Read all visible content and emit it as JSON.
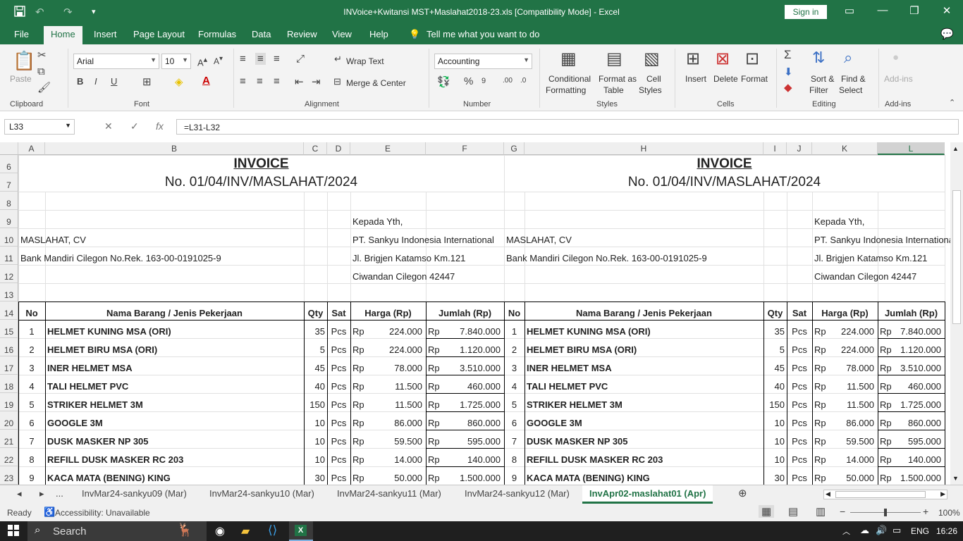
{
  "app": {
    "title": "INVoice+Kwitansi MST+Maslahat2018-23.xls  [Compatibility Mode]  -  Excel",
    "sign_in": "Sign in"
  },
  "menu_tabs": [
    "File",
    "Home",
    "Insert",
    "Page Layout",
    "Formulas",
    "Data",
    "Review",
    "View",
    "Help"
  ],
  "tell_me": "Tell me what you want to do",
  "ribbon": {
    "paste": "Paste",
    "clipboard": "Clipboard",
    "font_name": "Arial",
    "font_size": "10",
    "font_group": "Font",
    "wrap_text": "Wrap Text",
    "merge_center": "Merge & Center",
    "alignment": "Alignment",
    "number_format": "Accounting",
    "number_group": "Number",
    "conditional": "Conditional",
    "formatting": "Formatting",
    "format_as": "Format as",
    "table": "Table",
    "cell": "Cell",
    "styles_lbl": "Styles",
    "styles_group": "Styles",
    "insert": "Insert",
    "delete": "Delete",
    "format": "Format",
    "cells_group": "Cells",
    "sort": "Sort &",
    "filter": "Filter",
    "find": "Find &",
    "select": "Select",
    "editing_group": "Editing",
    "addins": "Add-ins",
    "addins_group": "Add-ins"
  },
  "formula_bar": {
    "name_box": "L33",
    "formula": "=L31-L32"
  },
  "columns": [
    "A",
    "B",
    "C",
    "D",
    "E",
    "F",
    "G",
    "H",
    "I",
    "J",
    "K",
    "L"
  ],
  "rows": [
    "6",
    "7",
    "8",
    "9",
    "10",
    "11",
    "12",
    "13",
    "14",
    "15",
    "16",
    "17",
    "18",
    "19",
    "20",
    "21",
    "22",
    "23"
  ],
  "invoice": {
    "title": "INVOICE",
    "number": "No. 01/04/INV/MASLAHAT/2024",
    "kepada": "Kepada Yth,",
    "company": "MASLAHAT, CV",
    "bank": "Bank Mandiri Cilegon No.Rek. 163-00-0191025-9",
    "client1": "PT. Sankyu Indonesia International",
    "client2": "Jl. Brigjen Katamso Km.121",
    "client3": "Ciwandan Cilegon 42447",
    "headers": [
      "No",
      "Nama Barang / Jenis Pekerjaan",
      "Qty",
      "Sat",
      "Harga (Rp)",
      "Jumlah (Rp)"
    ],
    "currency": "Rp",
    "items": [
      {
        "no": "1",
        "name": "HELMET KUNING MSA (ORI)",
        "qty": "35",
        "sat": "Pcs",
        "harga": "224.000",
        "jumlah": "7.840.000"
      },
      {
        "no": "2",
        "name": "HELMET BIRU MSA (ORI)",
        "qty": "5",
        "sat": "Pcs",
        "harga": "224.000",
        "jumlah": "1.120.000"
      },
      {
        "no": "3",
        "name": "INER HELMET MSA",
        "qty": "45",
        "sat": "Pcs",
        "harga": "78.000",
        "jumlah": "3.510.000"
      },
      {
        "no": "4",
        "name": "TALI HELMET PVC",
        "qty": "40",
        "sat": "Pcs",
        "harga": "11.500",
        "jumlah": "460.000"
      },
      {
        "no": "5",
        "name": "STRIKER HELMET 3M",
        "qty": "150",
        "sat": "Pcs",
        "harga": "11.500",
        "jumlah": "1.725.000"
      },
      {
        "no": "6",
        "name": "GOOGLE 3M",
        "qty": "10",
        "sat": "Pcs",
        "harga": "86.000",
        "jumlah": "860.000"
      },
      {
        "no": "7",
        "name": "DUSK MASKER NP 305",
        "qty": "10",
        "sat": "Pcs",
        "harga": "59.500",
        "jumlah": "595.000"
      },
      {
        "no": "8",
        "name": "REFILL DUSK MASKER RC 203",
        "qty": "10",
        "sat": "Pcs",
        "harga": "14.000",
        "jumlah": "140.000"
      },
      {
        "no": "9",
        "name": "KACA MATA (BENING) KING",
        "qty": "30",
        "sat": "Pcs",
        "harga": "50.000",
        "jumlah": "1.500.000"
      }
    ]
  },
  "sheet_tabs": [
    "...",
    "InvMar24-sankyu09 (Mar)",
    "InvMar24-sankyu10 (Mar)",
    "InvMar24-sankyu11 (Mar)",
    "InvMar24-sankyu12 (Mar)",
    "InvApr02-maslahat01 (Apr)"
  ],
  "status": {
    "ready": "Ready",
    "accessibility": "Accessibility: Unavailable",
    "zoom": "100%"
  },
  "taskbar": {
    "search": "Search",
    "lang": "ENG",
    "time": "16:26"
  },
  "colors": {
    "excel_green": "#217346"
  }
}
